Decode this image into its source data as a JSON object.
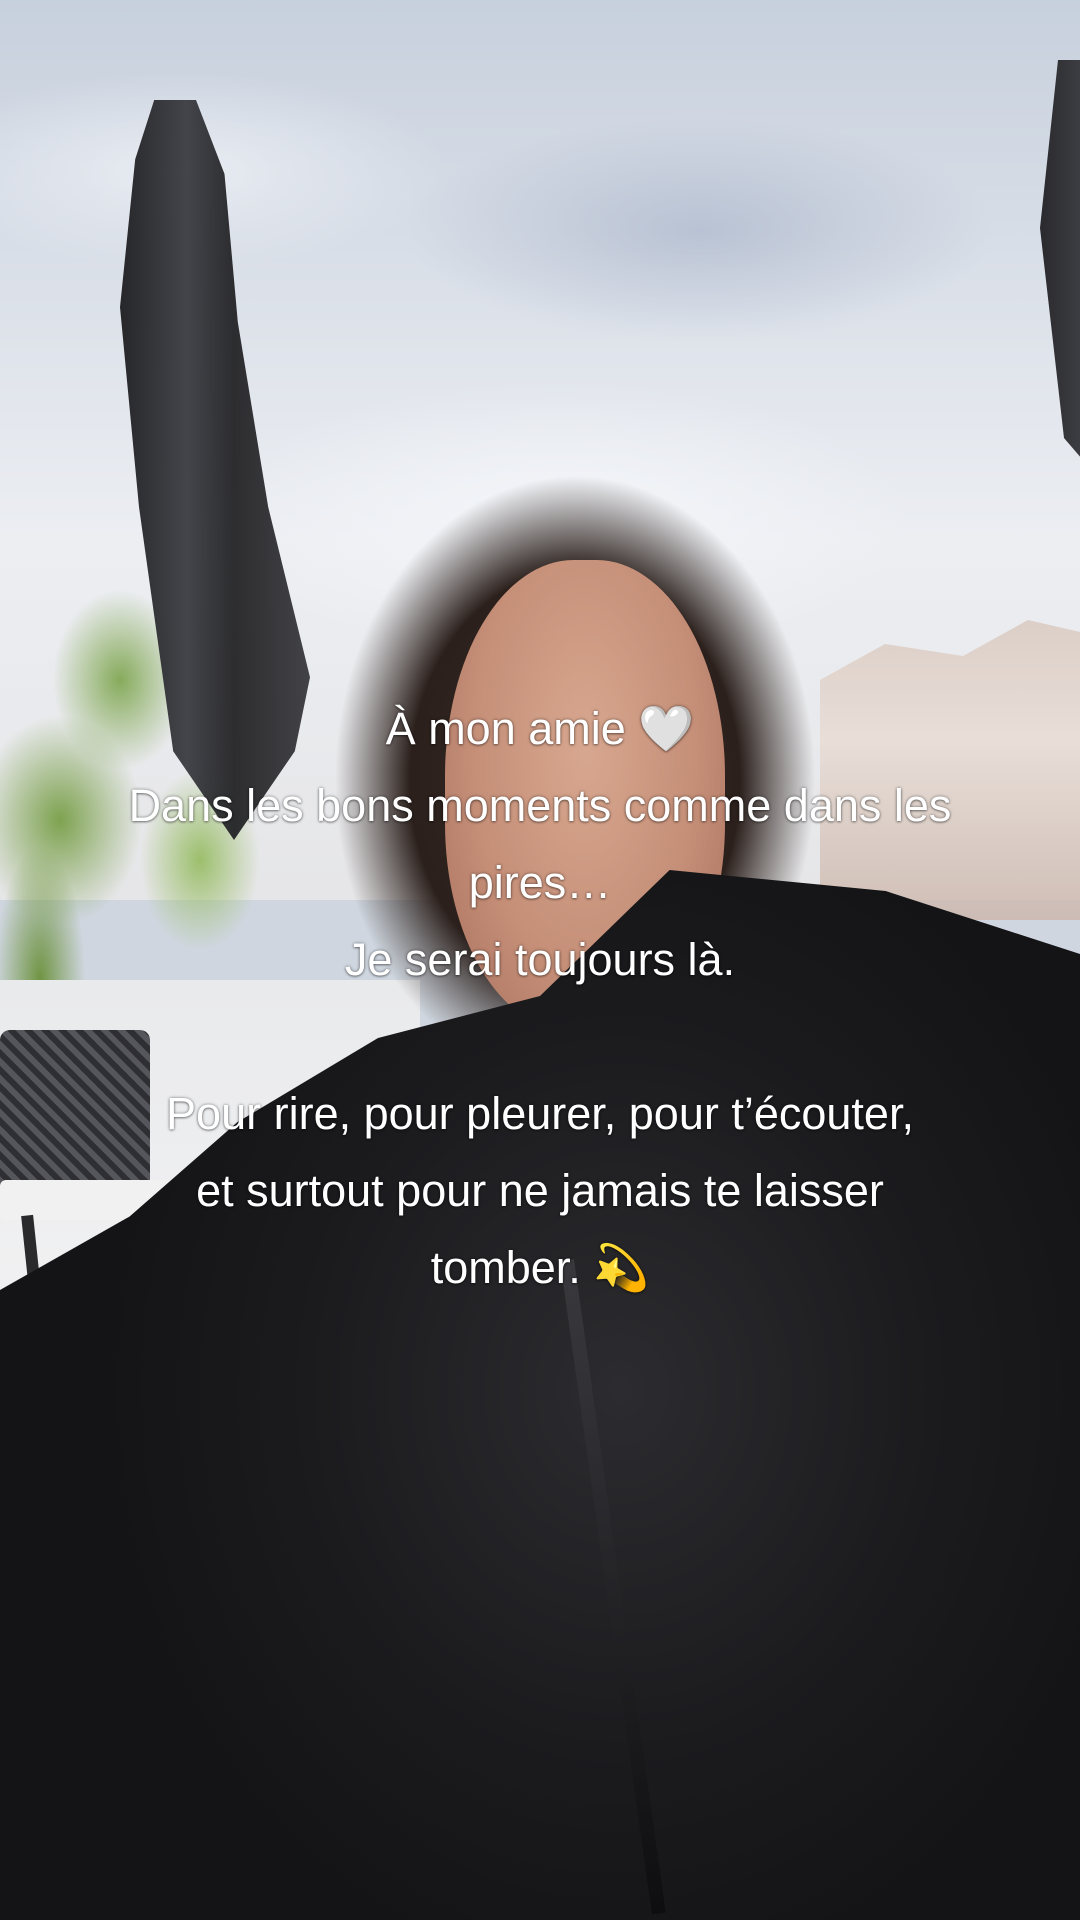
{
  "caption": {
    "line1": "À mon amie 🤍",
    "line2": "Dans les bons moments comme dans les",
    "line3": "pires…",
    "line4": "Je serai toujours là.",
    "line5": "Pour rire, pour pleurer, pour t’écouter,",
    "line6": "et surtout pour ne jamais te laisser",
    "line7": "tomber. 💫"
  },
  "colors": {
    "caption_text": "#ffffff",
    "jacket": "#1b1b1e",
    "sky": "#dde2ea"
  }
}
